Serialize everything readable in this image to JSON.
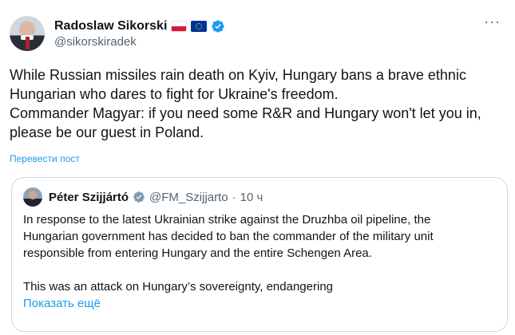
{
  "author": {
    "display_name": "Radoslaw Sikorski",
    "handle": "@sikorskiradek",
    "flags": [
      "poland-flag",
      "eu-flag"
    ],
    "verified": true
  },
  "post": {
    "lines": [
      "While Russian missiles rain death on Kyiv, Hungary bans a brave ethnic",
      "Hungarian who dares to fight for Ukraine's freedom.",
      "Commander Magyar: if you need some R&R and Hungary won't let you in,",
      "please be our guest in Poland."
    ],
    "translate_label": "Перевести пост"
  },
  "quote": {
    "display_name": "Péter Szijjártó",
    "handle": "@FM_Szijjarto",
    "separator": "·",
    "time": "10 ч",
    "lines": [
      "In response to the latest Ukrainian strike against the Druzhba oil pipeline, the",
      "Hungarian government has decided to ban the commander of the military unit",
      "responsible from entering Hungary and the entire Schengen Area."
    ],
    "lines2": [
      "This was an attack on Hungary’s sovereignty, endangering"
    ],
    "show_more_label": "Показать ещё"
  },
  "colors": {
    "text": "#0f1419",
    "secondary": "#536471",
    "link": "#1d9bf0",
    "border": "#cfd9de",
    "verified_blue": "#1d9bf0",
    "gov_gray": "#829aab"
  },
  "icons": {
    "more": "more-horizontal-icon",
    "verified": "verified-badge-icon",
    "gov_badge": "government-gray-badge-icon"
  }
}
